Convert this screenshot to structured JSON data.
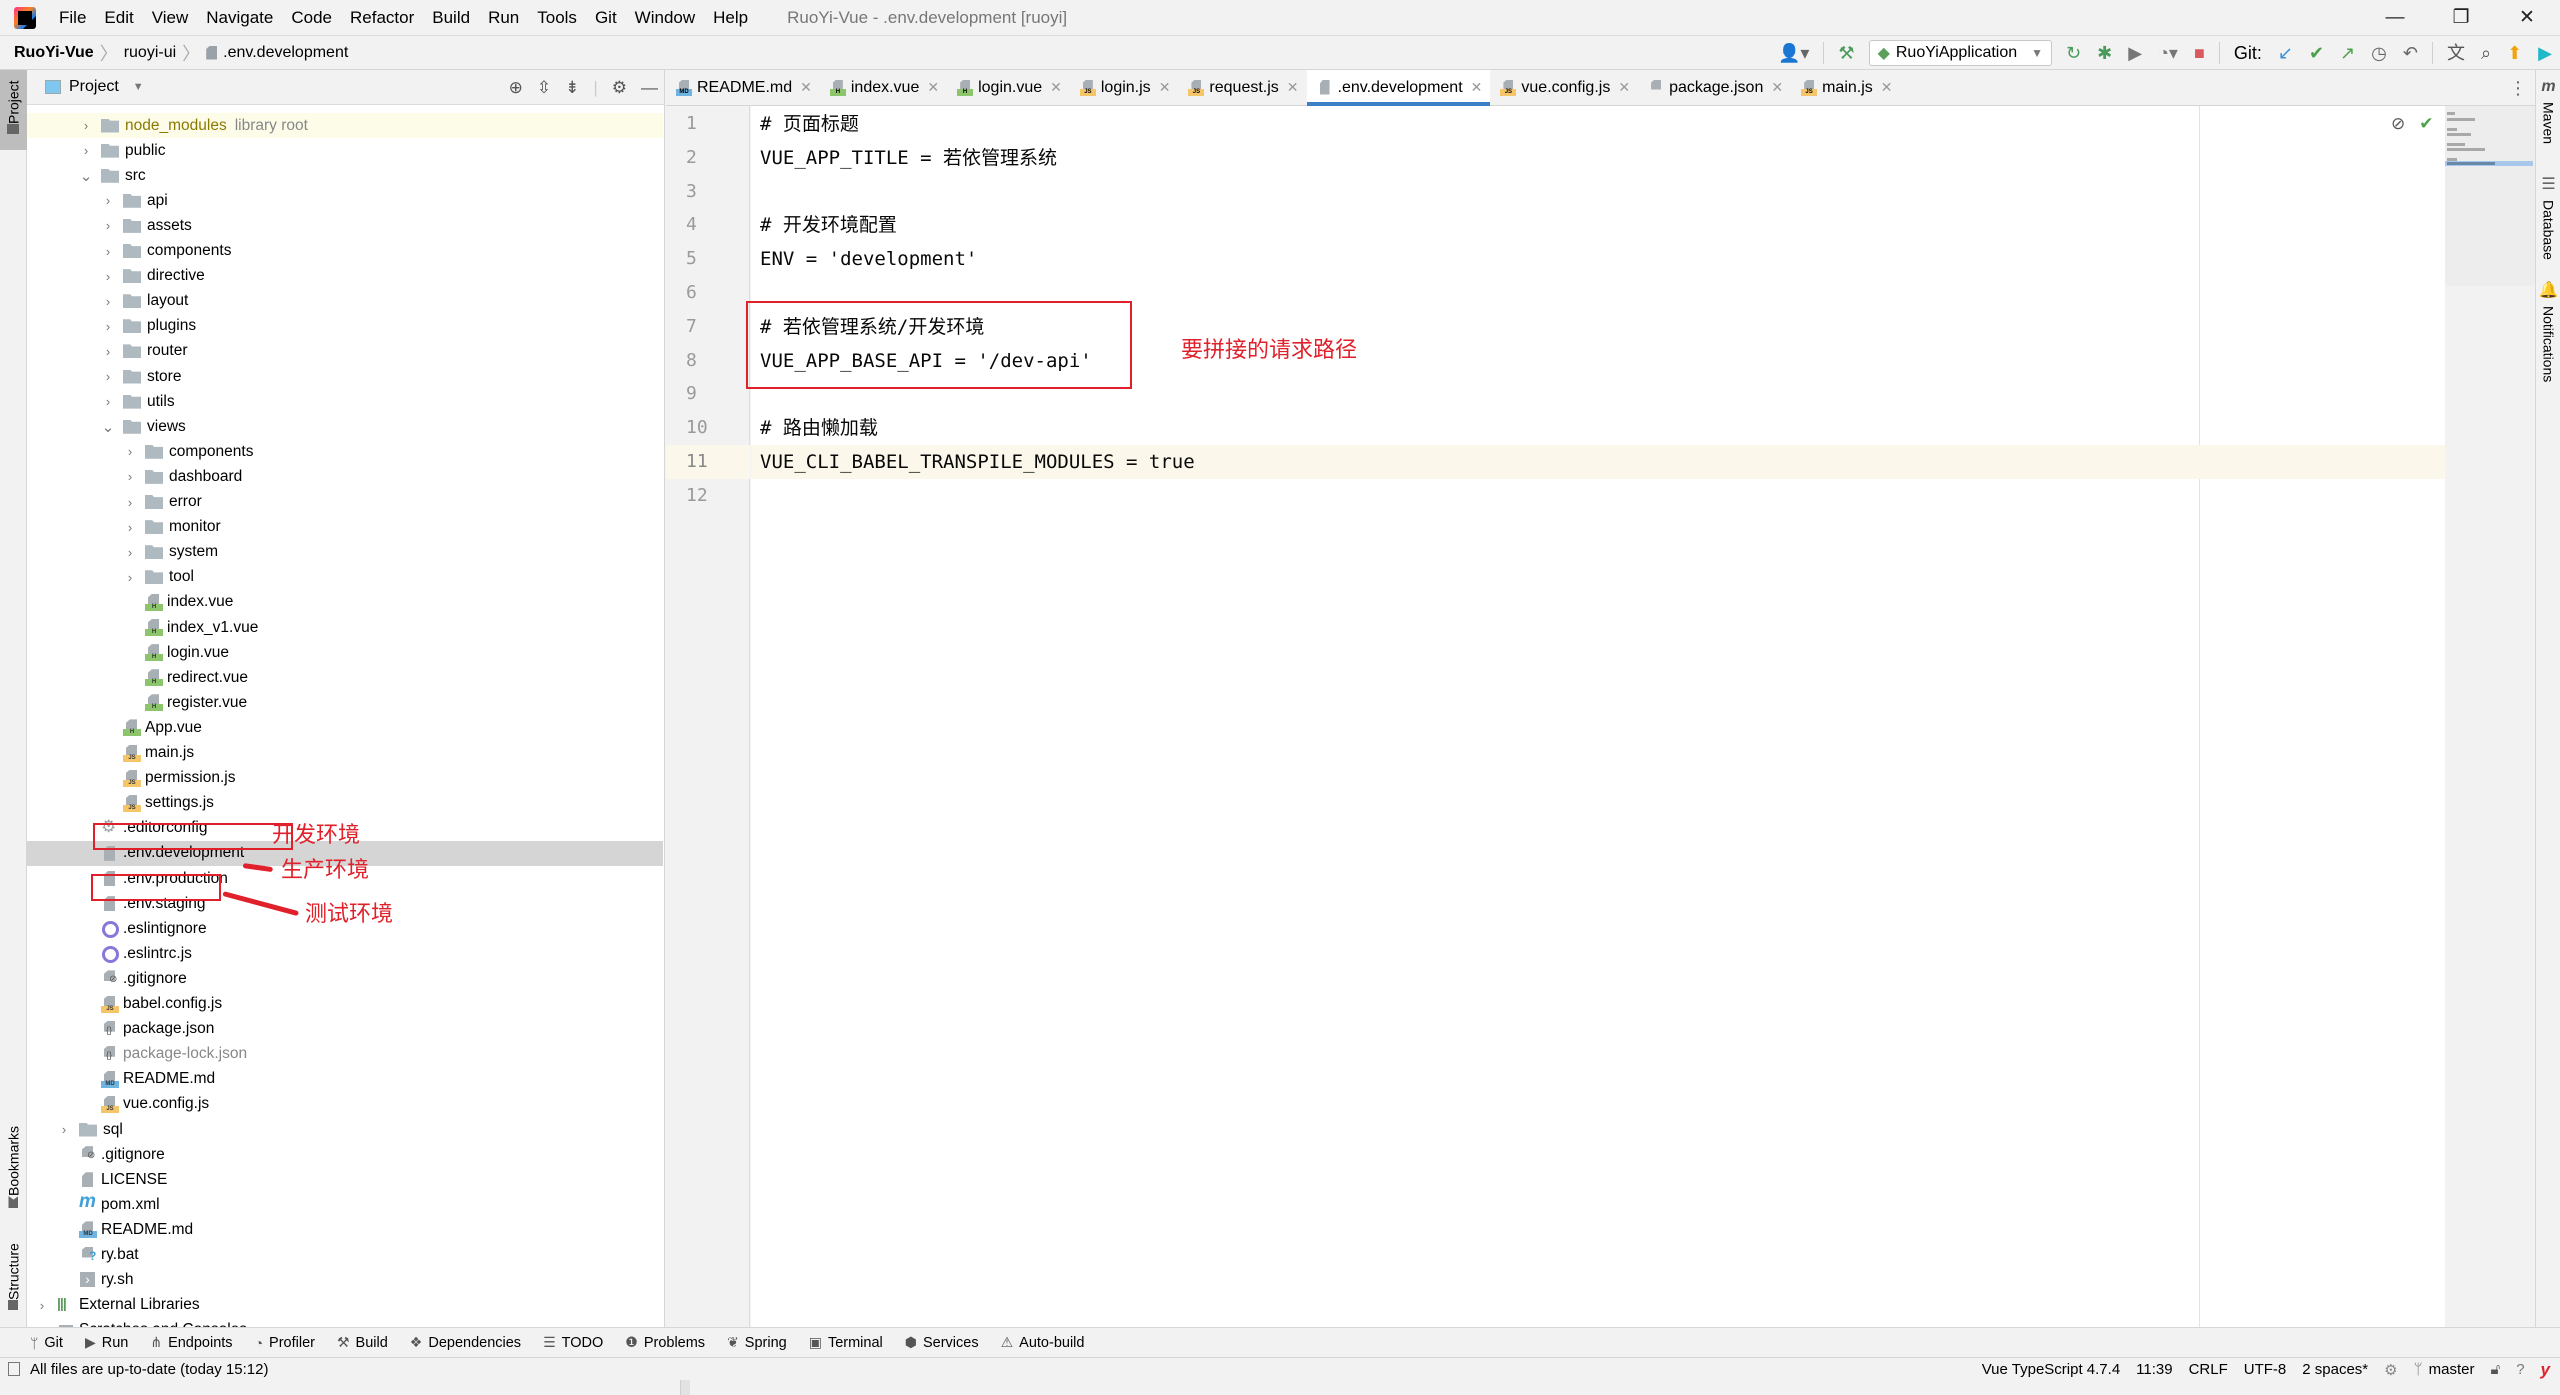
{
  "window": {
    "title": "RuoYi-Vue - .env.development [ruoyi]",
    "menu": [
      "File",
      "Edit",
      "View",
      "Navigate",
      "Code",
      "Refactor",
      "Build",
      "Run",
      "Tools",
      "Git",
      "Window",
      "Help"
    ],
    "controls": {
      "minimize": "—",
      "restore": "❐",
      "close": "✕"
    }
  },
  "navbar": {
    "breadcrumb": [
      "RuoYi-Vue",
      "ruoyi-ui",
      ".env.development"
    ],
    "run_config": "RuoYiApplication",
    "git_label": "Git:",
    "icons": [
      "user-icon",
      "build-hammer-icon",
      "rerun-icon",
      "debug-icon",
      "coverage-icon",
      "profile-icon",
      "stop-icon",
      "git-update-icon",
      "git-commit-icon",
      "git-push-icon",
      "history-icon",
      "rollback-icon",
      "translate-icon",
      "search-icon",
      "update-icon",
      "toolbox-icon"
    ]
  },
  "left_strip": {
    "project": "Project",
    "bookmarks": "Bookmarks",
    "structure": "Structure"
  },
  "project_panel": {
    "title": "Project",
    "tree": [
      {
        "label": "node_modules",
        "suffix": "library root",
        "type": "folder",
        "depth": 2,
        "expanded": false,
        "highlight": "library"
      },
      {
        "label": "public",
        "type": "folder",
        "depth": 2,
        "expanded": false
      },
      {
        "label": "src",
        "type": "folder",
        "depth": 2,
        "expanded": true
      },
      {
        "label": "api",
        "type": "folder",
        "depth": 3,
        "expanded": false
      },
      {
        "label": "assets",
        "type": "folder",
        "depth": 3,
        "expanded": false
      },
      {
        "label": "components",
        "type": "folder",
        "depth": 3,
        "expanded": false
      },
      {
        "label": "directive",
        "type": "folder",
        "depth": 3,
        "expanded": false
      },
      {
        "label": "layout",
        "type": "folder",
        "depth": 3,
        "expanded": false
      },
      {
        "label": "plugins",
        "type": "folder",
        "depth": 3,
        "expanded": false
      },
      {
        "label": "router",
        "type": "folder",
        "depth": 3,
        "expanded": false
      },
      {
        "label": "store",
        "type": "folder",
        "depth": 3,
        "expanded": false
      },
      {
        "label": "utils",
        "type": "folder",
        "depth": 3,
        "expanded": false
      },
      {
        "label": "views",
        "type": "folder",
        "depth": 3,
        "expanded": true
      },
      {
        "label": "components",
        "type": "folder",
        "depth": 4,
        "expanded": false
      },
      {
        "label": "dashboard",
        "type": "folder",
        "depth": 4,
        "expanded": false
      },
      {
        "label": "error",
        "type": "folder",
        "depth": 4,
        "expanded": false
      },
      {
        "label": "monitor",
        "type": "folder",
        "depth": 4,
        "expanded": false
      },
      {
        "label": "system",
        "type": "folder",
        "depth": 4,
        "expanded": false
      },
      {
        "label": "tool",
        "type": "folder",
        "depth": 4,
        "expanded": false
      },
      {
        "label": "index.vue",
        "type": "vue",
        "depth": 4
      },
      {
        "label": "index_v1.vue",
        "type": "vue",
        "depth": 4
      },
      {
        "label": "login.vue",
        "type": "vue",
        "depth": 4
      },
      {
        "label": "redirect.vue",
        "type": "vue",
        "depth": 4
      },
      {
        "label": "register.vue",
        "type": "vue",
        "depth": 4
      },
      {
        "label": "App.vue",
        "type": "vue",
        "depth": 3
      },
      {
        "label": "main.js",
        "type": "js",
        "depth": 3
      },
      {
        "label": "permission.js",
        "type": "js",
        "depth": 3
      },
      {
        "label": "settings.js",
        "type": "js",
        "depth": 3
      },
      {
        "label": ".editorconfig",
        "type": "gear",
        "depth": 2
      },
      {
        "label": ".env.development",
        "type": "txt",
        "depth": 2,
        "selected": true
      },
      {
        "label": ".env.production",
        "type": "txt",
        "depth": 2
      },
      {
        "label": ".env.staging",
        "type": "txt",
        "depth": 2
      },
      {
        "label": ".eslintignore",
        "type": "eslint",
        "depth": 2
      },
      {
        "label": ".eslintrc.js",
        "type": "eslint",
        "depth": 2
      },
      {
        "label": ".gitignore",
        "type": "ignore",
        "depth": 2
      },
      {
        "label": "babel.config.js",
        "type": "js",
        "depth": 2
      },
      {
        "label": "package.json",
        "type": "json",
        "depth": 2
      },
      {
        "label": "package-lock.json",
        "type": "json",
        "depth": 2,
        "muted": true
      },
      {
        "label": "README.md",
        "type": "md",
        "depth": 2
      },
      {
        "label": "vue.config.js",
        "type": "js",
        "depth": 2
      },
      {
        "label": "sql",
        "type": "folder",
        "depth": 1,
        "expanded": false
      },
      {
        "label": ".gitignore",
        "type": "ignore",
        "depth": 1
      },
      {
        "label": "LICENSE",
        "type": "txt",
        "depth": 1
      },
      {
        "label": "pom.xml",
        "type": "maven",
        "depth": 1
      },
      {
        "label": "README.md",
        "type": "md",
        "depth": 1
      },
      {
        "label": "ry.bat",
        "type": "bat",
        "depth": 1
      },
      {
        "label": "ry.sh",
        "type": "sh",
        "depth": 1
      },
      {
        "label": "External Libraries",
        "type": "extlib",
        "depth": 0,
        "expanded": false
      },
      {
        "label": "Scratches and Consoles",
        "type": "scratch",
        "depth": 0,
        "expanded": false
      }
    ],
    "annotations": {
      "development": "开发环境",
      "production": "生产环境",
      "staging": "测试环境"
    }
  },
  "tabs": [
    {
      "label": "README.md",
      "type": "md"
    },
    {
      "label": "index.vue",
      "type": "vue"
    },
    {
      "label": "login.vue",
      "type": "vue"
    },
    {
      "label": "login.js",
      "type": "js"
    },
    {
      "label": "request.js",
      "type": "js"
    },
    {
      "label": ".env.development",
      "type": "txt",
      "active": true
    },
    {
      "label": "vue.config.js",
      "type": "js"
    },
    {
      "label": "package.json",
      "type": "json"
    },
    {
      "label": "main.js",
      "type": "js"
    }
  ],
  "editor": {
    "lines": [
      {
        "n": "1",
        "text": "# 页面标题"
      },
      {
        "n": "2",
        "text": "VUE_APP_TITLE = 若依管理系统"
      },
      {
        "n": "3",
        "text": ""
      },
      {
        "n": "4",
        "text": "# 开发环境配置"
      },
      {
        "n": "5",
        "text": "ENV = 'development'"
      },
      {
        "n": "6",
        "text": ""
      },
      {
        "n": "7",
        "text": "# 若依管理系统/开发环境"
      },
      {
        "n": "8",
        "text": "VUE_APP_BASE_API = '/dev-api'"
      },
      {
        "n": "9",
        "text": ""
      },
      {
        "n": "10",
        "text": "# 路由懒加载"
      },
      {
        "n": "11",
        "text": "VUE_CLI_BABEL_TRANSPILE_MODULES = true",
        "current": true
      },
      {
        "n": "12",
        "text": ""
      }
    ],
    "annotation": "要拼接的请求路径"
  },
  "right_strip": [
    "Maven",
    "Database",
    "Notifications"
  ],
  "bottom_tabs": [
    {
      "label": "Git",
      "icon": "git-branch-icon"
    },
    {
      "label": "Run",
      "icon": "run-icon"
    },
    {
      "label": "Endpoints",
      "icon": "endpoints-icon"
    },
    {
      "label": "Profiler",
      "icon": "profiler-icon"
    },
    {
      "label": "Build",
      "icon": "build-icon"
    },
    {
      "label": "Dependencies",
      "icon": "dependencies-icon"
    },
    {
      "label": "TODO",
      "icon": "todo-icon"
    },
    {
      "label": "Problems",
      "icon": "problems-icon"
    },
    {
      "label": "Spring",
      "icon": "spring-icon"
    },
    {
      "label": "Terminal",
      "icon": "terminal-icon"
    },
    {
      "label": "Services",
      "icon": "services-icon"
    },
    {
      "label": "Auto-build",
      "icon": "auto-build-icon"
    }
  ],
  "status": {
    "message": "All files are up-to-date (today 15:12)",
    "language": "Vue TypeScript 4.7.4",
    "position": "11:39",
    "line_ending": "CRLF",
    "encoding": "UTF-8",
    "indent": "2 spaces*",
    "branch": "master"
  }
}
